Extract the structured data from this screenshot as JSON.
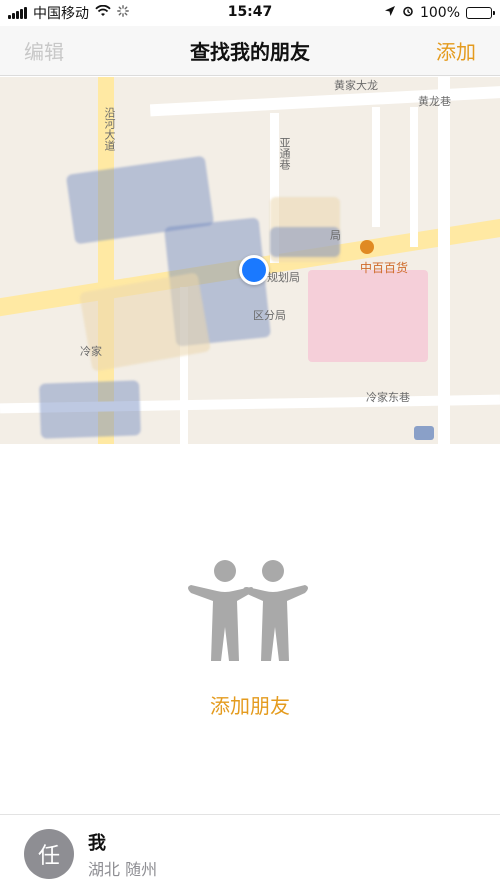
{
  "status_bar": {
    "carrier": "中国移动",
    "time": "15:47",
    "battery_text": "100%"
  },
  "nav": {
    "left_label": "编辑",
    "title": "查找我的朋友",
    "right_label": "添加"
  },
  "map": {
    "labels": {
      "street_vertical": "沿河大道",
      "street_top": "黄家大龙",
      "alley_top_right": "黄龙巷",
      "alley_vertical": "亚通巷",
      "street_bottom": "冷家东巷",
      "planning_bureau": "乡规划局",
      "district_branch": "区分局",
      "left_label": "冷家",
      "bureau_top": "局"
    },
    "poi": {
      "department_store": "中百百货"
    }
  },
  "empty_state": {
    "add_friends_label": "添加朋友"
  },
  "me": {
    "avatar_text": "任",
    "name": "我",
    "location": "湖北 随州"
  },
  "colors": {
    "accent": "#e49b1e",
    "battery_green": "#34c759"
  }
}
